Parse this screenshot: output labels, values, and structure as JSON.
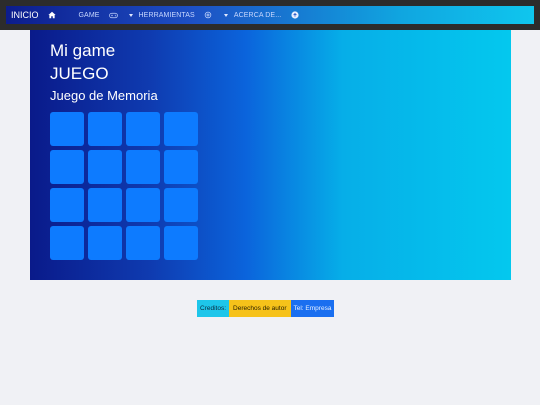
{
  "navbar": {
    "brand": "INICIO",
    "items": [
      {
        "label": "GAME",
        "icon": "gamepad-icon"
      },
      {
        "label": "HERRAMIENTAS",
        "icon": "gear-icon"
      },
      {
        "label": "ACERCA DE...",
        "icon": "info-icon"
      }
    ]
  },
  "hero": {
    "title": "Mi game",
    "heading": "JUEGO",
    "subtitle": "Juego de Memoria"
  },
  "board": {
    "rows": 4,
    "cols": 4,
    "card_color": "#0d7bff"
  },
  "footer": {
    "credits": "Creditos:",
    "rights": "Derechos de autor",
    "tel": "Tel: Empresa"
  },
  "colors": {
    "hero_start": "#0a1a8a",
    "hero_end": "#04c8ee",
    "credits_bg": "#1ec6ea",
    "rights_bg": "#f6c21a",
    "tel_bg": "#1a6ff0"
  }
}
